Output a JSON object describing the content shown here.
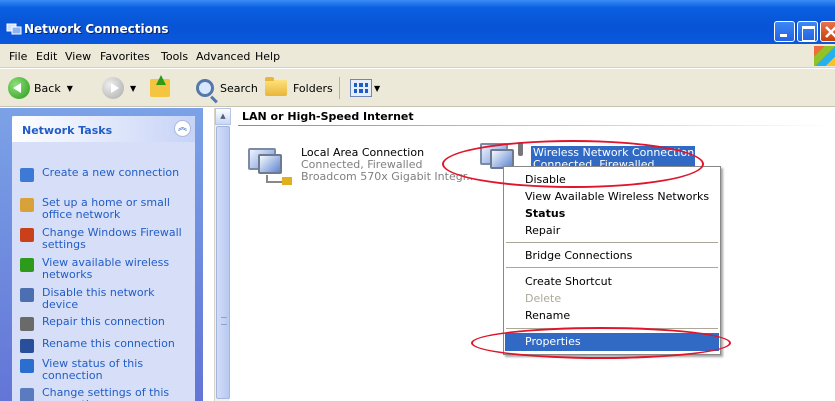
{
  "window": {
    "title": "Network Connections"
  },
  "menu": [
    "File",
    "Edit",
    "View",
    "Favorites",
    "Tools",
    "Advanced",
    "Help"
  ],
  "toolbar": {
    "back": "Back",
    "search": "Search",
    "folders": "Folders"
  },
  "tasks": {
    "header": "Network Tasks",
    "items": [
      {
        "label": "Create a new connection",
        "icon": "new-connection-icon",
        "color": "#3d7ad6"
      },
      {
        "label": "Set up a home or small office network",
        "icon": "home-network-icon",
        "color": "#d9a13a"
      },
      {
        "label": "Change Windows Firewall settings",
        "icon": "firewall-icon",
        "color": "#c8411a"
      },
      {
        "label": "View available wireless networks",
        "icon": "wireless-icon",
        "color": "#2e9a1c"
      },
      {
        "label": "Disable this network device",
        "icon": "disable-icon",
        "color": "#4b6fb0"
      },
      {
        "label": "Repair this connection",
        "icon": "repair-icon",
        "color": "#6a6a6a"
      },
      {
        "label": "Rename this connection",
        "icon": "rename-icon",
        "color": "#2a4f9a"
      },
      {
        "label": "View status of this connection",
        "icon": "status-icon",
        "color": "#2a6fd0"
      },
      {
        "label": "Change settings of this connection",
        "icon": "settings-icon",
        "color": "#5b7bc0"
      }
    ]
  },
  "main": {
    "section": "LAN or High-Speed Internet",
    "lan": {
      "name": "Local Area Connection",
      "status": "Connected, Firewalled",
      "device": "Broadcom 570x Gigabit Integr..."
    },
    "wireless": {
      "name": "Wireless Network Connection",
      "status": "Connected, Firewalled"
    }
  },
  "context_menu": {
    "items": [
      {
        "label": "Disable"
      },
      {
        "label": "View Available Wireless Networks"
      },
      {
        "label": "Status",
        "bold": true
      },
      {
        "label": "Repair"
      },
      {
        "label": "Bridge Connections"
      },
      {
        "label": "Create Shortcut"
      },
      {
        "label": "Delete",
        "disabled": true
      },
      {
        "label": "Rename"
      },
      {
        "label": "Properties",
        "selected": true
      }
    ]
  },
  "colors": {
    "selection": "#316ac5",
    "link": "#215dc6",
    "annotation": "#e0142a"
  }
}
